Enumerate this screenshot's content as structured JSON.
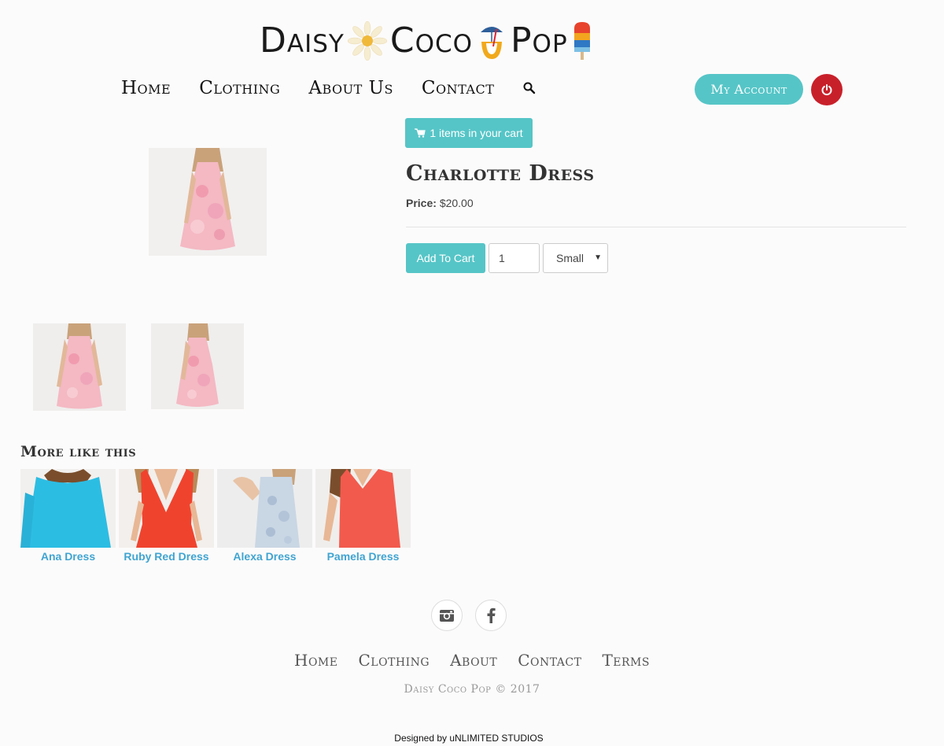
{
  "brand": {
    "name_parts": [
      "Daisy",
      "Coco",
      "Pop"
    ]
  },
  "nav": {
    "items": [
      "Home",
      "Clothing",
      "About Us",
      "Contact"
    ],
    "search_icon": "search-icon",
    "account_label": "My Account",
    "logout_icon": "power-icon"
  },
  "cart": {
    "label": "1 items in your cart",
    "icon": "cart-icon"
  },
  "product": {
    "title": "Charlotte Dress",
    "price_label": "Price:",
    "price_value": "$20.00",
    "add_to_cart_label": "Add To Cart",
    "quantity": "1",
    "size_selected": "Small"
  },
  "related": {
    "title": "More like this",
    "items": [
      {
        "name": "Ana Dress",
        "color": "#2cbde3"
      },
      {
        "name": "Ruby Red Dress",
        "color": "#f0432e"
      },
      {
        "name": "Alexa Dress",
        "color": "#c9d6e4"
      },
      {
        "name": "Pamela Dress",
        "color": "#f25a4d"
      }
    ]
  },
  "footer": {
    "social": [
      "instagram-icon",
      "facebook-icon"
    ],
    "nav": [
      "Home",
      "Clothing",
      "About",
      "Contact",
      "Terms"
    ],
    "copyright": "Daisy Coco Pop © 2017",
    "credit": "Designed by uNLIMITED STUDIOS"
  },
  "colors": {
    "accent": "#56c5c7",
    "logout": "#c8202a",
    "link": "#3fa4d1",
    "background": "#fcfbfb"
  }
}
